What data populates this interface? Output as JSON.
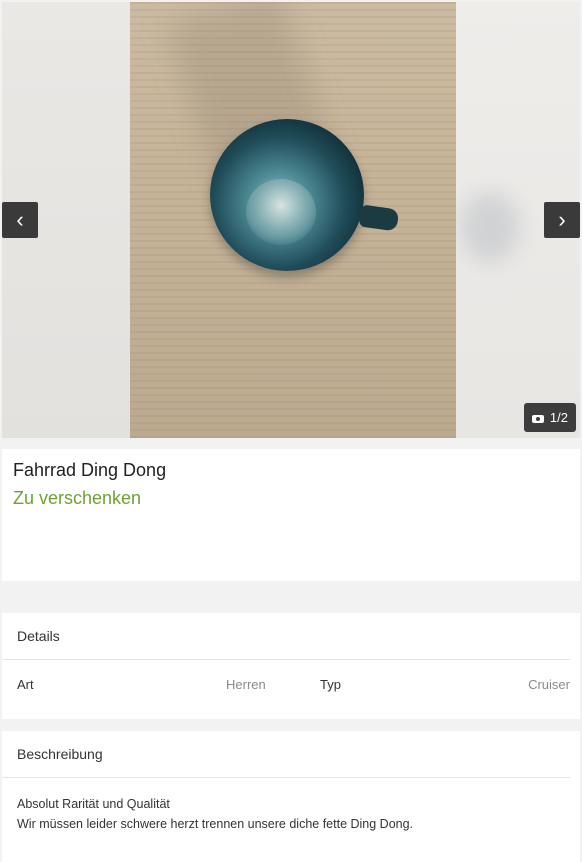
{
  "gallery": {
    "prev_icon": "chevron-left-icon",
    "next_icon": "chevron-right-icon",
    "counter": "1/2",
    "counter_icon": "camera-icon"
  },
  "listing": {
    "title": "Fahrrad Ding Dong",
    "price": "Zu verschenken",
    "price_color": "#6da233"
  },
  "details": {
    "header": "Details",
    "rows": [
      {
        "label": "Art",
        "value": "Herren"
      },
      {
        "label": "Typ",
        "value": "Cruiser"
      }
    ]
  },
  "description": {
    "header": "Beschreibung",
    "lines": [
      "Absolut Rarität und Qualität",
      "Wir müssen leider schwere herzt trennen unsere diche fette Ding Dong."
    ]
  }
}
